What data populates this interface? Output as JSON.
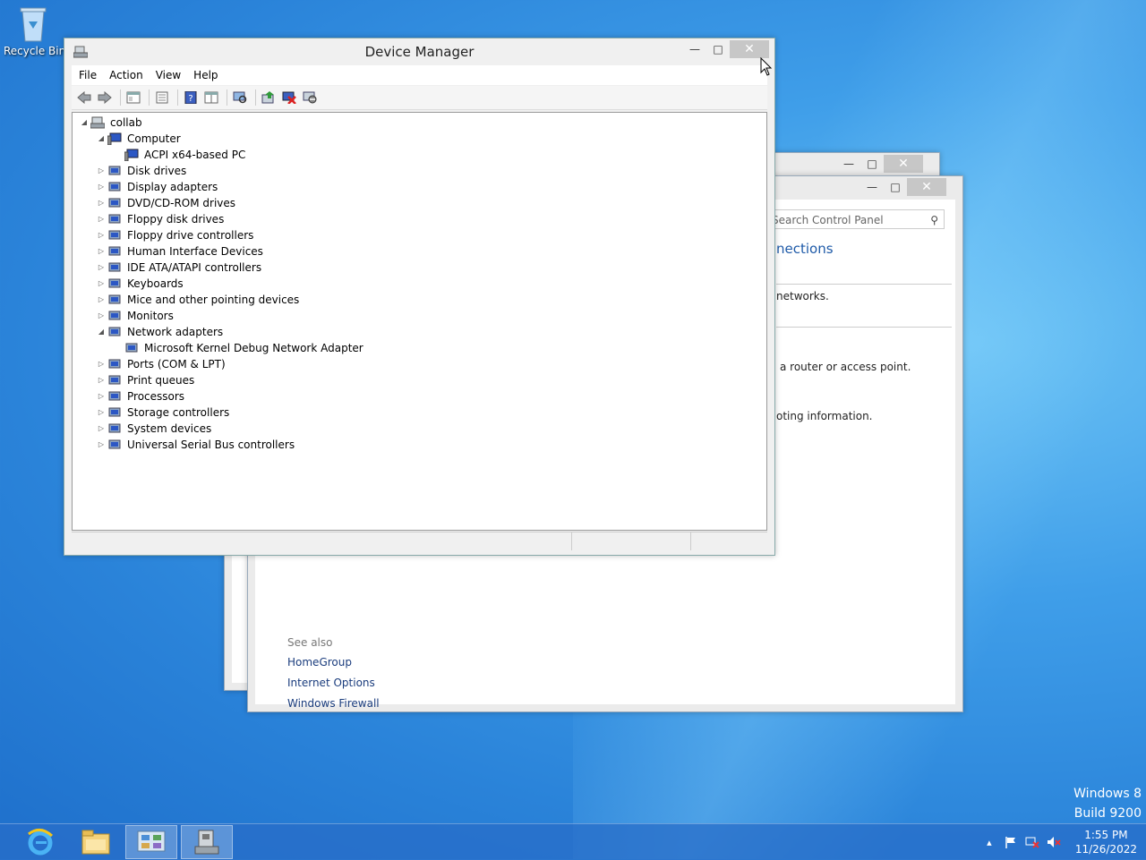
{
  "desktop": {
    "recycle_bin_label": "Recycle Bin",
    "watermark_line1": "Windows 8",
    "watermark_line2": "Build 9200"
  },
  "back_window": {
    "search_placeholder": "Search Control Panel",
    "heading": "nections",
    "text1": "networks.",
    "text2": "a router or access point.",
    "text3": "oting information.",
    "see_also_title": "See also",
    "see_also_links": [
      "HomeGroup",
      "Internet Options",
      "Windows Firewall"
    ]
  },
  "device_manager": {
    "title": "Device Manager",
    "menu": [
      "File",
      "Action",
      "View",
      "Help"
    ],
    "tree": {
      "root": "collab",
      "computer": "Computer",
      "computer_child": "ACPI x64-based PC",
      "categories": [
        "Disk drives",
        "Display adapters",
        "DVD/CD-ROM drives",
        "Floppy disk drives",
        "Floppy drive controllers",
        "Human Interface Devices",
        "IDE ATA/ATAPI controllers",
        "Keyboards",
        "Mice and other pointing devices",
        "Monitors",
        "Network adapters"
      ],
      "network_child": "Microsoft Kernel Debug Network Adapter",
      "categories_after": [
        "Ports (COM & LPT)",
        "Print queues",
        "Processors",
        "Storage controllers",
        "System devices",
        "Universal Serial Bus controllers"
      ]
    }
  },
  "taskbar": {
    "time": "1:55 PM",
    "date": "11/26/2022"
  },
  "colors": {
    "desktop_blue": "#2a83d9",
    "link_blue": "#1a3c7d",
    "close_button": "#c7c7c7"
  }
}
